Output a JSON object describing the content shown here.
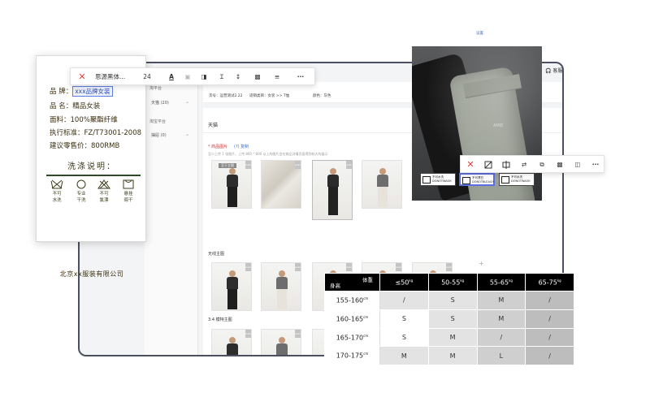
{
  "header": {
    "service_label": "客服"
  },
  "sidebar": {
    "groups": [
      {
        "title": "淘平台",
        "item": "天猫 (20)"
      },
      {
        "title": "淘宝平台",
        "item": "抽屉 (0)"
      }
    ]
  },
  "topstrip": {
    "meta": [
      "货号：运营测试2.22",
      "适销类目：女装 >> T恤",
      "颜色：灰色"
    ],
    "link": "设置"
  },
  "content": {
    "channel": "天猫",
    "product_images": {
      "title": "* 商品图片",
      "action": "(?) 复制",
      "note": "至少上传 1 张图片，上传 800 * 800 以上的图片会在商品详情页面得到较大的展示",
      "thumb_badge": "至于主图",
      "tag": "Auto"
    },
    "wireless_main": {
      "title": "无线主图"
    },
    "portrait_main": {
      "title": "3:4 模特主图"
    }
  },
  "label_card": {
    "brand_label": "品  牌：",
    "brand_value": "xxx品牌女装",
    "name": "品  名：精品女装",
    "fabric": "面料：100%聚酯纤维",
    "standard": "执行标准：FZ/T73001-2008",
    "price": "建议零售价：800RMB",
    "care_title": "洗涤说明：",
    "care": [
      {
        "label": "不可\n水洗",
        "icon": "no-wash-icon"
      },
      {
        "label": "专业\n干洗",
        "icon": "dry-clean-icon"
      },
      {
        "label": "不可\n氯漂",
        "icon": "no-bleach-icon"
      },
      {
        "label": "悬挂\n晾干",
        "icon": "hang-dry-icon"
      }
    ],
    "company": "北京xx服装有限公司"
  },
  "text_toolbar": {
    "font": "思源黑体...",
    "size": "24",
    "icons": [
      "close-icon",
      "text-color-icon",
      "fill-icon",
      "layer-icon",
      "text-spacing-icon",
      "line-height-icon",
      "opacity-icon",
      "align-icon",
      "more-icon"
    ]
  },
  "photo": {
    "brand_mark": "AMIE",
    "wash_chips": [
      {
        "text": "不可水洗\nDONOTWASH"
      },
      {
        "text": "不可漂白\nDONOTBLEACH"
      },
      {
        "text": "不可水洗\nDONOTWASH"
      }
    ]
  },
  "image_toolbar": {
    "icons": [
      "close-icon",
      "crop-icon",
      "flip-icon",
      "replace-icon",
      "copy-icon",
      "opacity-icon",
      "layer-icon",
      "more-icon"
    ]
  },
  "size_table": {
    "corner_top": "体重",
    "corner_bottom": "身高",
    "columns": [
      {
        "label": "≤50",
        "unit": "kg"
      },
      {
        "label": "50-55",
        "unit": "kg"
      },
      {
        "label": "55-65",
        "unit": "kg"
      },
      {
        "label": "65-75",
        "unit": "kg"
      }
    ],
    "rows": [
      {
        "height": "155-160",
        "unit": "cm",
        "values": [
          "/",
          "S",
          "M",
          "/"
        ]
      },
      {
        "height": "160-165",
        "unit": "cm",
        "values": [
          "S",
          "S",
          "M",
          "/"
        ]
      },
      {
        "height": "165-170",
        "unit": "cm",
        "values": [
          "S",
          "M",
          "/",
          "/"
        ]
      },
      {
        "height": "170-175",
        "unit": "cm",
        "values": [
          "M",
          "M",
          "L",
          "/"
        ]
      }
    ]
  }
}
